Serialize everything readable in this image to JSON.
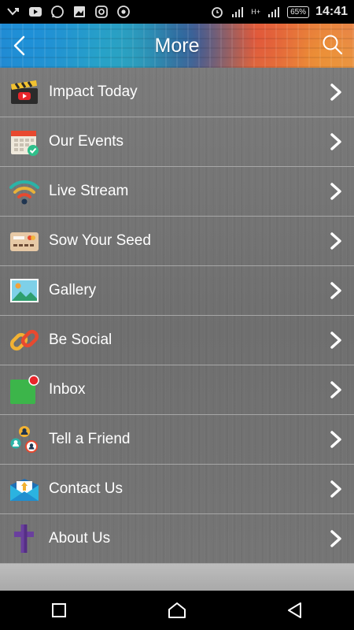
{
  "status_bar": {
    "icons": [
      "missed-call-icon",
      "youtube-icon",
      "whatsapp-icon",
      "gallery-icon",
      "instagram-icon",
      "chrome-icon"
    ],
    "right_icons": [
      "alarm-icon",
      "signal-icon",
      "h-plus-signal-icon"
    ],
    "network": "H+",
    "battery": "65%",
    "time": "14:41"
  },
  "header": {
    "title": "More",
    "back_icon": "chevron-left-icon",
    "search_icon": "search-icon"
  },
  "menu": {
    "items": [
      {
        "label": "Impact Today",
        "icon": "clapperboard-icon"
      },
      {
        "label": "Our Events",
        "icon": "calendar-icon"
      },
      {
        "label": "Live Stream",
        "icon": "wifi-icon"
      },
      {
        "label": "Sow Your Seed",
        "icon": "credit-card-icon"
      },
      {
        "label": "Gallery",
        "icon": "picture-icon"
      },
      {
        "label": "Be Social",
        "icon": "link-icon"
      },
      {
        "label": "Inbox",
        "icon": "inbox-icon"
      },
      {
        "label": "Tell a Friend",
        "icon": "friends-icon"
      },
      {
        "label": "Contact Us",
        "icon": "envelope-icon"
      },
      {
        "label": "About Us",
        "icon": "cross-icon"
      }
    ]
  },
  "nav_bar": {
    "buttons": [
      "recent-apps-icon",
      "home-icon",
      "back-icon"
    ]
  },
  "colors": {
    "row_divider": "#a7a7a7",
    "list_background": "#747474",
    "inbox_green": "#3cb54a",
    "notification_red": "#e8262b"
  }
}
